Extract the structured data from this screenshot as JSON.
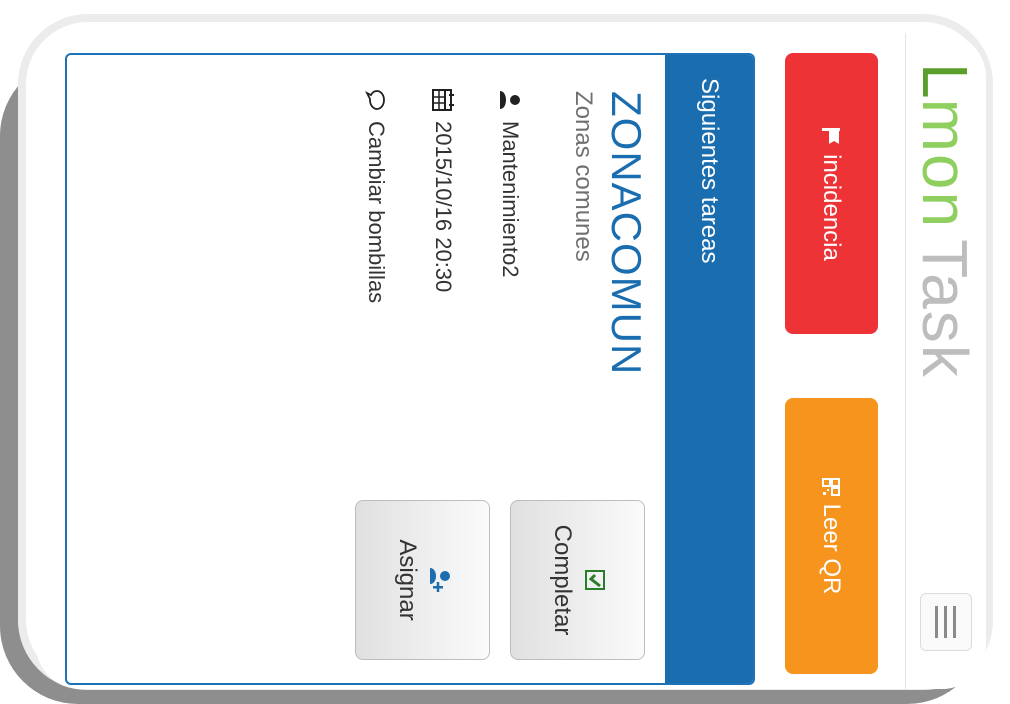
{
  "app": {
    "logo_first": "L",
    "logo_rest": "mon",
    "logo_task": "Task"
  },
  "actions": {
    "incidencia_label": "incidencia",
    "qr_label": "Leer QR"
  },
  "panel": {
    "header": "Siguientes tareas",
    "zone_code": "ZONACOMUN",
    "zone_name": "Zonas comunes",
    "user": "Mantenimiento2",
    "datetime": "2015/10/16 20:30",
    "task": "Cambiar bombillas",
    "complete_label": "Completar",
    "assign_label": "Asignar"
  },
  "colors": {
    "incidencia": "#ee3337",
    "qr": "#f7941d",
    "panel_header": "#1a6daf",
    "logo_green": "#8fcf5f"
  },
  "icons": {
    "incidencia": "flag-icon",
    "qr": "qr-code-icon",
    "complete": "check-square-icon",
    "assign": "user-plus-icon",
    "user": "user-icon",
    "date": "calendar-icon",
    "task": "comment-icon",
    "menu": "hamburger-menu-icon"
  }
}
